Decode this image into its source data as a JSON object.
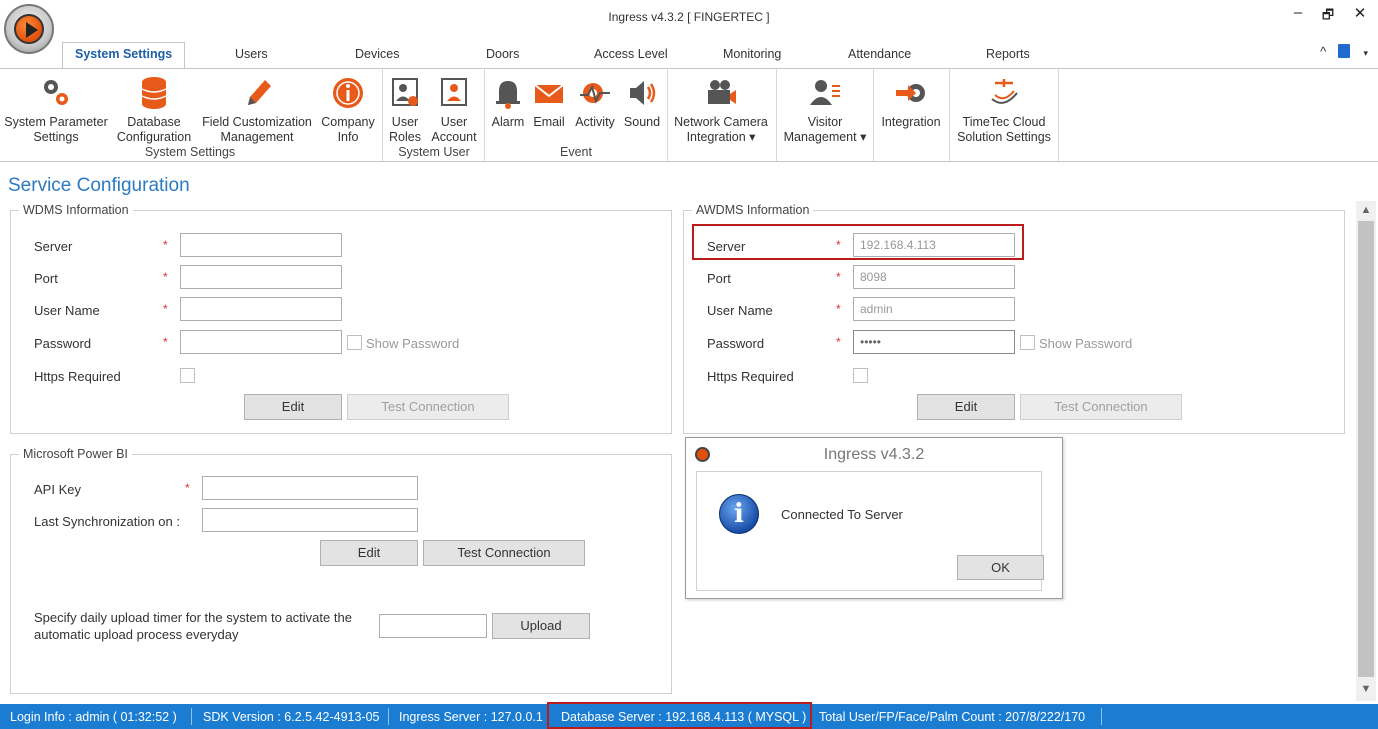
{
  "window": {
    "title": "Ingress v4.3.2 [ FINGERTEC ]",
    "minimize": "–",
    "restore": "🗗",
    "close": "✕"
  },
  "tabs": [
    {
      "label": "System Settings",
      "active": true
    },
    {
      "label": "Users"
    },
    {
      "label": "Devices"
    },
    {
      "label": "Doors"
    },
    {
      "label": "Access Level"
    },
    {
      "label": "Monitoring"
    },
    {
      "label": "Attendance"
    },
    {
      "label": "Reports"
    }
  ],
  "tabs_right": {
    "collapse": "^",
    "more": "▾"
  },
  "ribbon": {
    "items": [
      {
        "l1": "System Parameter",
        "l2": "Settings",
        "icon": "gears-icon"
      },
      {
        "l1": "Database",
        "l2": "Configuration",
        "icon": "database-icon"
      },
      {
        "l1": "Field Customization",
        "l2": "Management",
        "icon": "pencil-icon"
      },
      {
        "l1": "Company",
        "l2": "Info",
        "icon": "info-icon"
      },
      {
        "l1": "User",
        "l2": "Roles",
        "icon": "user-roles-icon"
      },
      {
        "l1": "User",
        "l2": "Account",
        "icon": "user-account-icon"
      },
      {
        "l1": "Alarm",
        "l2": "",
        "icon": "bell-icon"
      },
      {
        "l1": "Email",
        "l2": "",
        "icon": "envelope-icon"
      },
      {
        "l1": "Activity",
        "l2": "",
        "icon": "activity-icon"
      },
      {
        "l1": "Sound",
        "l2": "",
        "icon": "speaker-icon"
      },
      {
        "l1": "Network Camera",
        "l2": "Integration ▾",
        "icon": "camera-icon"
      },
      {
        "l1": "Visitor",
        "l2": "Management ▾",
        "icon": "visitor-icon"
      },
      {
        "l1": "Integration",
        "l2": "",
        "icon": "integration-icon"
      },
      {
        "l1": "TimeTec Cloud",
        "l2": "Solution Settings",
        "icon": "timetec-icon"
      }
    ],
    "groups": [
      "System Settings",
      "System User",
      "Event"
    ]
  },
  "page_title": "Service Configuration",
  "wdms": {
    "legend": "WDMS Information",
    "server_label": "Server",
    "port_label": "Port",
    "username_label": "User Name",
    "password_label": "Password",
    "https_label": "Https Required",
    "show_password": "Show Password",
    "required_mark": "*",
    "server": "",
    "port": "",
    "username": "",
    "password": "",
    "edit": "Edit",
    "test": "Test Connection"
  },
  "awdms": {
    "legend": "AWDMS Information",
    "server_label": "Server",
    "port_label": "Port",
    "username_label": "User Name",
    "password_label": "Password",
    "https_label": "Https Required",
    "show_password": "Show Password",
    "required_mark": "*",
    "server": "192.168.4.113",
    "port": "8098",
    "username": "admin",
    "password": "•••••",
    "edit": "Edit",
    "test": "Test Connection"
  },
  "powerbi": {
    "legend": "Microsoft Power BI",
    "api_label": "API Key",
    "last_sync_label": "Last Synchronization on :",
    "required_mark": "*",
    "api_key": "",
    "last_sync": "",
    "edit": "Edit",
    "test": "Test Connection",
    "upload_desc_1": "Specify daily upload timer for the system to activate the",
    "upload_desc_2": "automatic upload process everyday",
    "upload_time": "",
    "upload": "Upload"
  },
  "dialog": {
    "title": "Ingress v4.3.2",
    "message": "Connected To Server",
    "ok": "OK",
    "icon_glyph": "i"
  },
  "scroll": {
    "up": "▲",
    "down": "▼"
  },
  "status": {
    "login": "Login Info : admin ( 01:32:52 )",
    "sdk": "SDK Version : 6.2.5.42-4913-05",
    "ingress_server": "Ingress Server : 127.0.0.1",
    "database_server": "Database Server : 192.168.4.113 ( MYSQL )",
    "counts": "Total User/FP/Face/Palm Count : 207/8/222/170"
  }
}
